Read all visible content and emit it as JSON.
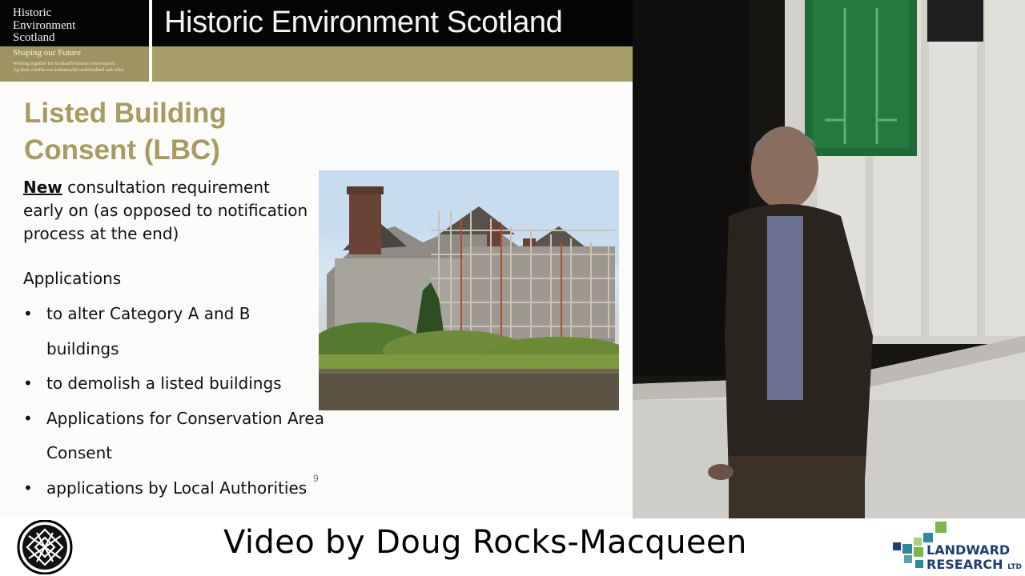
{
  "slide": {
    "logo_lines": [
      "Historic",
      "Environment",
      "Scotland"
    ],
    "logo_subtitle": "Shaping our Future",
    "logo_tagline_1": "Working together for Scotland's historic environment",
    "logo_tagline_2": "Ag obair còmhla son àrainneachd eachdraidheil nah-Alba",
    "banner_title": "Historic Environment Scotland",
    "heading_line_1": "Listed Building",
    "heading_line_2": "Consent (LBC)",
    "para_bold": "New",
    "para_rest": " consultation requirement  early on (as opposed to notification process at the end)",
    "applications_label": "Applications",
    "bullets": [
      "to alter Category A and B buildings",
      "to demolish a listed buildings",
      "Applications for Conservation Area Consent",
      "applications by Local Authorities"
    ],
    "page_number": "9"
  },
  "caption": {
    "text": "Video by Doug Rocks-Macqueen",
    "brand_line_1": "LANDWARD",
    "brand_line_2": "RESEARCH",
    "brand_ltd": "LTD"
  },
  "colors": {
    "olive_band": "#a79e6a",
    "heading_gold": "#a89a60",
    "brand_blue": "#1d3f73",
    "brand_green": "#7ab648",
    "brand_teal": "#2e8a9a"
  },
  "icons": {
    "caption_left_logo": "celtic-knot-icon",
    "caption_right_logo": "landward-squares-icon"
  }
}
